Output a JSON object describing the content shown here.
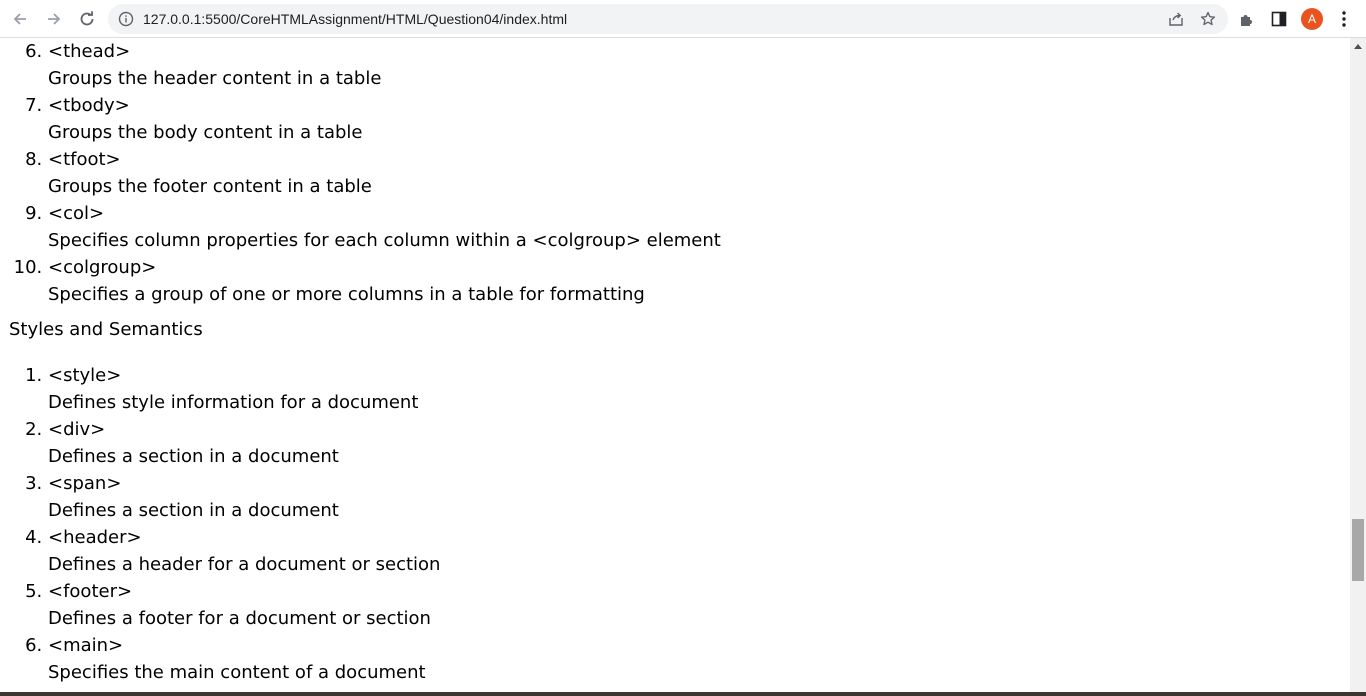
{
  "browser": {
    "url": "127.0.0.1:5500/CoreHTMLAssignment/HTML/Question04/index.html",
    "profile_initial": "A",
    "profile_color": "#e8541e",
    "icons": [
      "back-arrow-icon",
      "forward-arrow-icon",
      "reload-icon",
      "info-icon",
      "share-icon",
      "star-icon",
      "extensions-icon",
      "side-panel-icon",
      "more-vert-icon"
    ]
  },
  "table_list": {
    "items": [
      {
        "num": "6.",
        "term": "<thead>",
        "desc": "Groups the header content in a table"
      },
      {
        "num": "7.",
        "term": "<tbody>",
        "desc": "Groups the body content in a table"
      },
      {
        "num": "8.",
        "term": "<tfoot>",
        "desc": "Groups the footer content in a table"
      },
      {
        "num": "9.",
        "term": "<col>",
        "desc": "Specifies column properties for each column within a <colgroup> element"
      },
      {
        "num": "10.",
        "term": "<colgroup>",
        "desc": "Specifies a group of one or more columns in a table for formatting"
      }
    ]
  },
  "styles_section": {
    "heading": "Styles and Semantics",
    "items": [
      {
        "num": "1.",
        "term": "<style>",
        "desc": "Defines style information for a document"
      },
      {
        "num": "2.",
        "term": "<div>",
        "desc": "Defines a section in a document"
      },
      {
        "num": "3.",
        "term": "<span>",
        "desc": "Defines a section in a document"
      },
      {
        "num": "4.",
        "term": "<header>",
        "desc": "Defines a header for a document or section"
      },
      {
        "num": "5.",
        "term": "<footer>",
        "desc": "Defines a footer for a document or section"
      },
      {
        "num": "6.",
        "term": "<main>",
        "desc": "Specifies the main content of a document"
      }
    ]
  }
}
